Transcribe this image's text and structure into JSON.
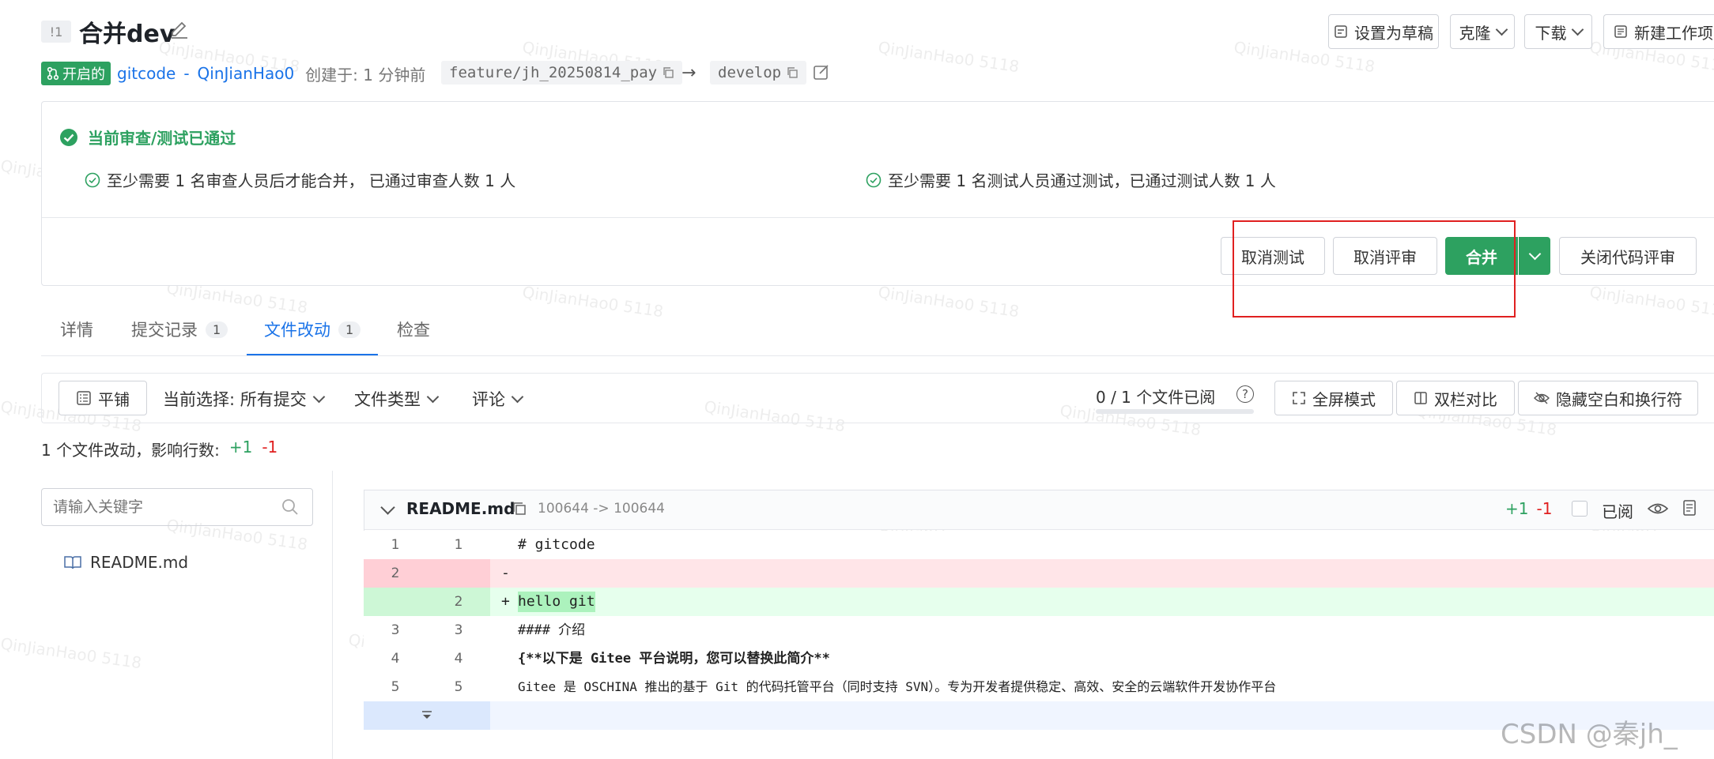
{
  "header": {
    "mr_id": "!1",
    "title": "合并dev",
    "status": "开启的",
    "repo": "gitcode",
    "separator": "-",
    "author": "QinJianHao0",
    "created_label": "创建于: 1 分钟前",
    "source_branch": "feature/jh_20250814_pay",
    "target_branch": "develop",
    "actions": {
      "draft": "设置为草稿",
      "clone": "克隆",
      "download": "下载",
      "new_workspace": "新建工作项"
    }
  },
  "review": {
    "status_title": "当前审查/测试已通过",
    "review_rule": "至少需要 1 名审查人员后才能合并， 已通过审查人数 1 人",
    "test_rule": "至少需要 1 名测试人员通过测试，已通过测试人数 1 人",
    "buttons": {
      "cancel_test": "取消测试",
      "cancel_review": "取消评审",
      "merge": "合并",
      "close_review": "关闭代码评审"
    }
  },
  "tabs": [
    {
      "label": "详情",
      "count": ""
    },
    {
      "label": "提交记录",
      "count": "1"
    },
    {
      "label": "文件改动",
      "count": "1"
    },
    {
      "label": "检查",
      "count": ""
    }
  ],
  "toolbar": {
    "flat": "平铺",
    "current_selection": "当前选择: 所有提交",
    "file_type": "文件类型",
    "comments": "评论",
    "viewed_progress": "0 / 1 个文件已阅",
    "viewed_fraction": 0,
    "fullscreen": "全屏模式",
    "split": "双栏对比",
    "hide_whitespace": "隐藏空白和换行符"
  },
  "summary": {
    "label": "1 个文件改动，影响行数:",
    "additions": "+1",
    "deletions": "-1"
  },
  "sidebar": {
    "search_placeholder": "请输入关键字",
    "files": [
      "README.md"
    ]
  },
  "diff": {
    "filename": "README.md",
    "mode": "100644 -> 100644",
    "additions": "+1",
    "deletions": "-1",
    "viewed_label": "已阅",
    "rows": [
      {
        "old": "1",
        "new": "1",
        "sign": " ",
        "text": "# gitcode",
        "type": "ctx"
      },
      {
        "old": "2",
        "new": "",
        "sign": "-",
        "text": "",
        "type": "del"
      },
      {
        "old": "",
        "new": "2",
        "sign": "+",
        "text": "hello git",
        "type": "add"
      },
      {
        "old": "3",
        "new": "3",
        "sign": " ",
        "text": "#### 介绍",
        "type": "ctx"
      },
      {
        "old": "4",
        "new": "4",
        "sign": " ",
        "text": "{**以下是 Gitee 平台说明，您可以替换此简介**",
        "type": "ctx"
      },
      {
        "old": "5",
        "new": "5",
        "sign": " ",
        "text": "Gitee 是 OSCHINA 推出的基于 Git 的代码托管平台（同时支持 SVN）。专为开发者提供稳定、高效、安全的云端软件开发协作平台",
        "type": "ctx"
      }
    ]
  },
  "watermark": "QinJianHao0 5118",
  "footer_watermark": "CSDN @秦jh_",
  "colors": {
    "accent": "#1a73e8",
    "green": "#2da160",
    "red_highlight": "#e02020",
    "del_bg": "#ffe5e8",
    "add_bg": "#e6ffed"
  }
}
